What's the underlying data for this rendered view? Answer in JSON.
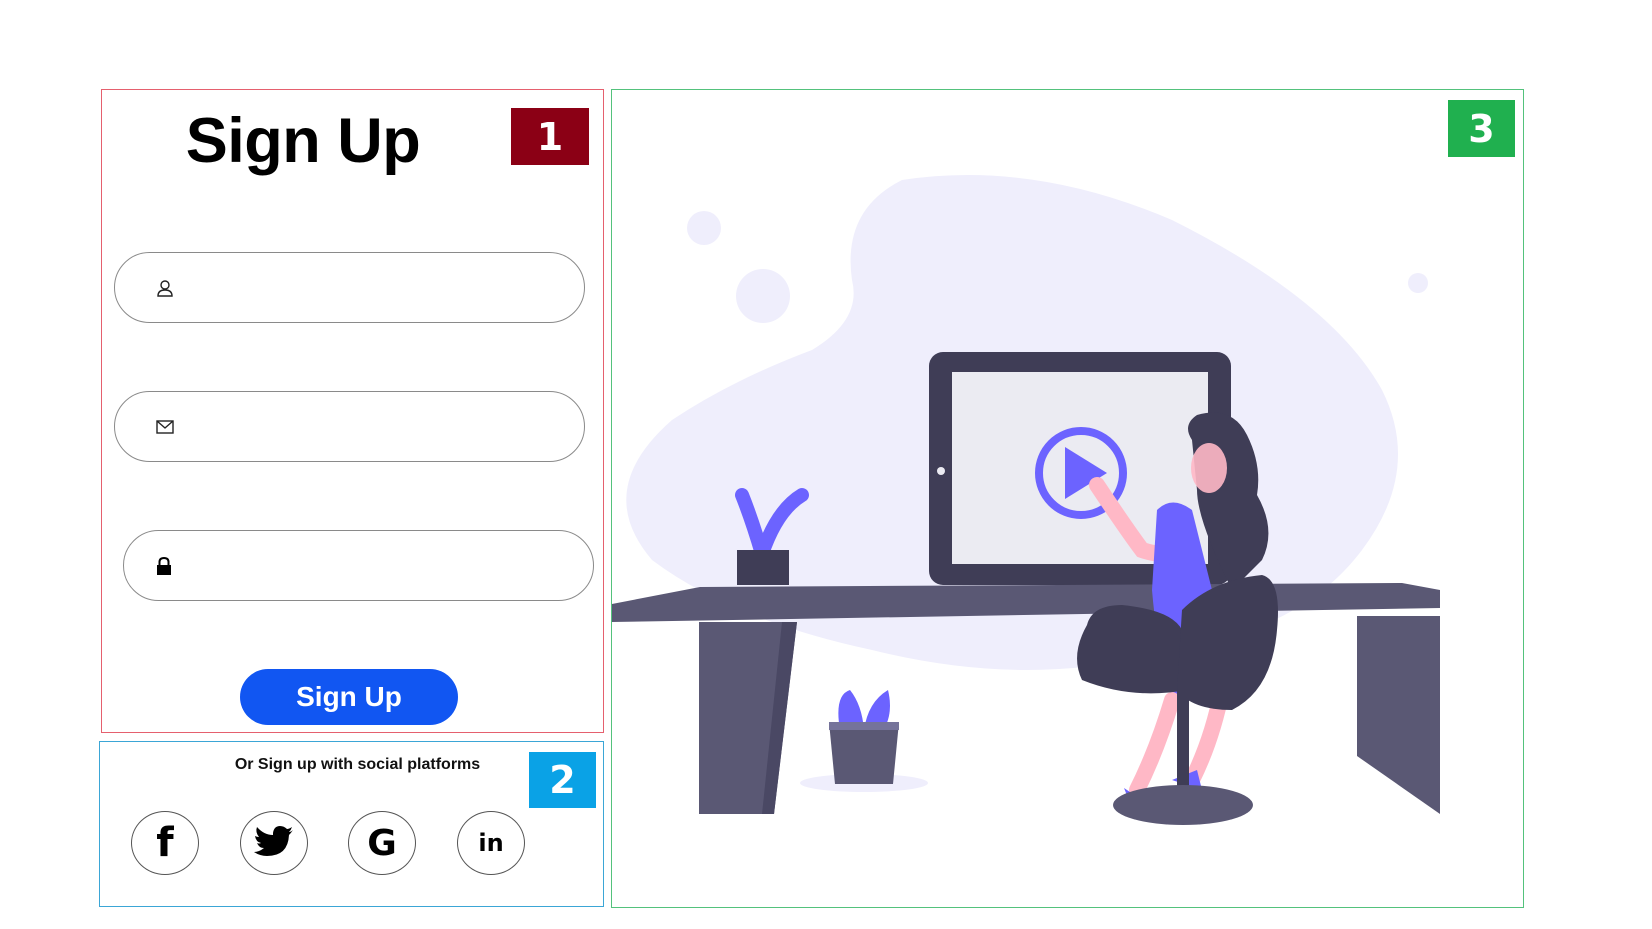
{
  "form": {
    "title": "Sign Up",
    "fields": [
      {
        "name": "username",
        "icon": "user-icon",
        "value": "",
        "placeholder": ""
      },
      {
        "name": "email",
        "icon": "mail-icon",
        "value": "",
        "placeholder": ""
      },
      {
        "name": "password",
        "icon": "lock-icon",
        "value": "",
        "placeholder": ""
      }
    ],
    "submit_label": "Sign Up"
  },
  "social": {
    "text": "Or Sign up with social platforms",
    "items": [
      {
        "name": "facebook",
        "icon": "facebook-icon",
        "glyph": "f"
      },
      {
        "name": "twitter",
        "icon": "twitter-icon",
        "glyph": ""
      },
      {
        "name": "google",
        "icon": "google-icon",
        "glyph": "G"
      },
      {
        "name": "linkedin",
        "icon": "linkedin-icon",
        "glyph": "in"
      }
    ]
  },
  "annotations": {
    "badge1": "1",
    "badge2": "2",
    "badge3": "3"
  },
  "colors": {
    "badge1": "#8b0015",
    "badge2": "#0aa2e6",
    "badge3": "#20b04f",
    "accent": "#1156f2",
    "illustration_purple": "#6c63ff",
    "illustration_dark": "#3f3d56",
    "blob": "#efeefc"
  }
}
